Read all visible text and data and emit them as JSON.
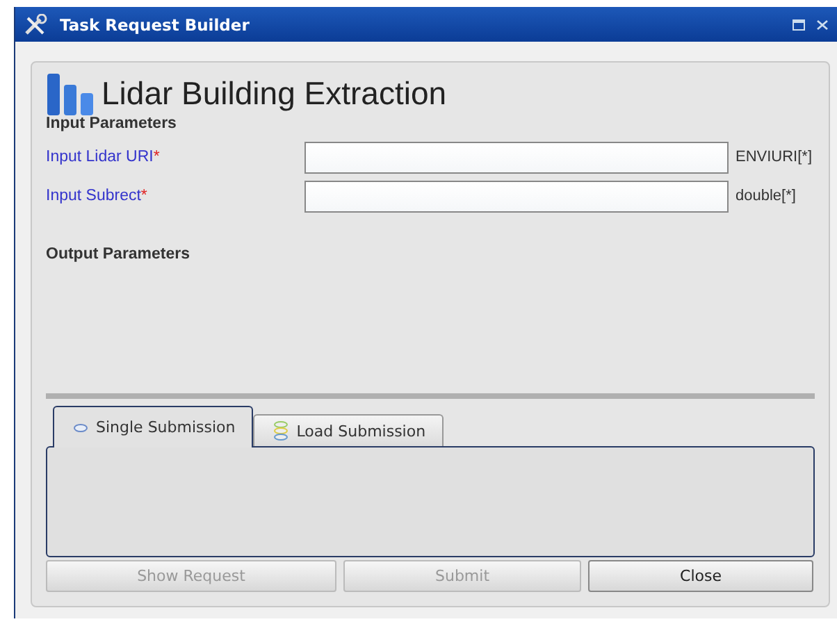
{
  "window": {
    "title": "Task Request Builder"
  },
  "task": {
    "title": "Lidar Building Extraction"
  },
  "input_parameters": {
    "heading": "Input Parameters",
    "items": [
      {
        "label": "Input Lidar URI",
        "required": true,
        "required_mark": "*",
        "type": "ENVIURI[*]"
      },
      {
        "label": "Input Subrect",
        "required": true,
        "required_mark": "*",
        "type": "double[*]"
      }
    ]
  },
  "output_parameters": {
    "heading": "Output Parameters"
  },
  "tabs": [
    {
      "label": "Single Submission",
      "selected": true,
      "kind": "single"
    },
    {
      "label": "Load Submission",
      "selected": false,
      "kind": "load"
    }
  ],
  "buttons": [
    {
      "label": "Show Request",
      "disabled": true
    },
    {
      "label": "Submit",
      "disabled": true
    },
    {
      "label": "Close",
      "disabled": false
    }
  ]
}
